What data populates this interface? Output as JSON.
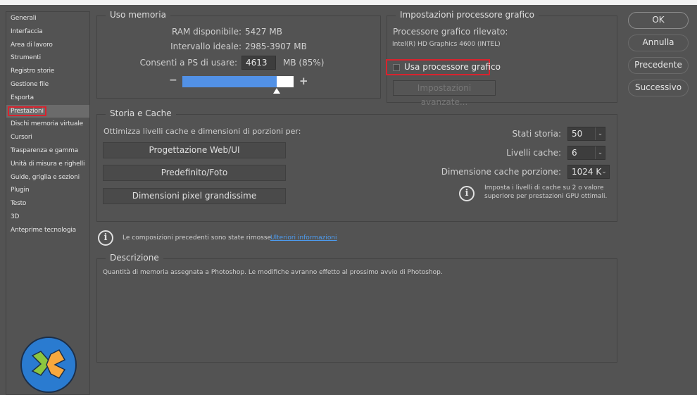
{
  "sidebar": {
    "items": [
      "Generali",
      "Interfaccia",
      "Area di lavoro",
      "Strumenti",
      "Registro storie",
      "Gestione file",
      "Esporta",
      "Prestazioni",
      "Dischi memoria virtuale",
      "Cursori",
      "Trasparenza e gamma",
      "Unità di misura e righelli",
      "Guide, griglia e sezioni",
      "Plugin",
      "Testo",
      "3D",
      "Anteprime tecnologia"
    ],
    "selected": "Prestazioni"
  },
  "memory": {
    "title": "Uso memoria",
    "ram_label": "RAM disponibile:",
    "ram_value": "5427 MB",
    "ideal_label": "Intervallo ideale:",
    "ideal_value": "2985-3907 MB",
    "allow_label": "Consenti a PS di usare:",
    "allow_value": "4613",
    "allow_unit": "MB (85%)",
    "minus": "−",
    "plus": "+",
    "slider_percent": 85
  },
  "gpu": {
    "title": "Impostazioni processore grafico",
    "detected_label": "Processore grafico rilevato:",
    "detected_value": "Intel(R) HD Graphics 4600 (INTEL)",
    "use_gpu_label": "Usa processore grafico",
    "use_gpu_checked": false,
    "advanced_label": "Impostazioni avanzate..."
  },
  "buttons": {
    "ok": "OK",
    "cancel": "Annulla",
    "prev": "Precedente",
    "next": "Successivo"
  },
  "cache": {
    "title": "Storia e Cache",
    "optimize_label": "Ottimizza livelli cache e dimensioni di porzioni per:",
    "presets": [
      "Progettazione Web/UI",
      "Predefinito/Foto",
      "Dimensioni pixel grandissime"
    ],
    "history_label": "Stati storia:",
    "history_value": "50",
    "levels_label": "Livelli cache:",
    "levels_value": "6",
    "tile_label": "Dimensione cache porzione:",
    "tile_value": "1024 K",
    "hint": "Imposta i livelli di cache su 2 o valore",
    "hint2": "superiore per prestazioni GPU ottimali."
  },
  "notice": {
    "text": "Le composizioni precedenti sono state rimosse",
    "link": "Ulteriori informazioni"
  },
  "description": {
    "title": "Descrizione",
    "text": "Quantità di memoria assegnata a Photoshop. Le modifiche avranno effetto al prossimo avvio di Photoshop."
  },
  "colors": {
    "accent": "#5291e6",
    "highlight": "#d9232e",
    "link": "#4d9cf0"
  }
}
